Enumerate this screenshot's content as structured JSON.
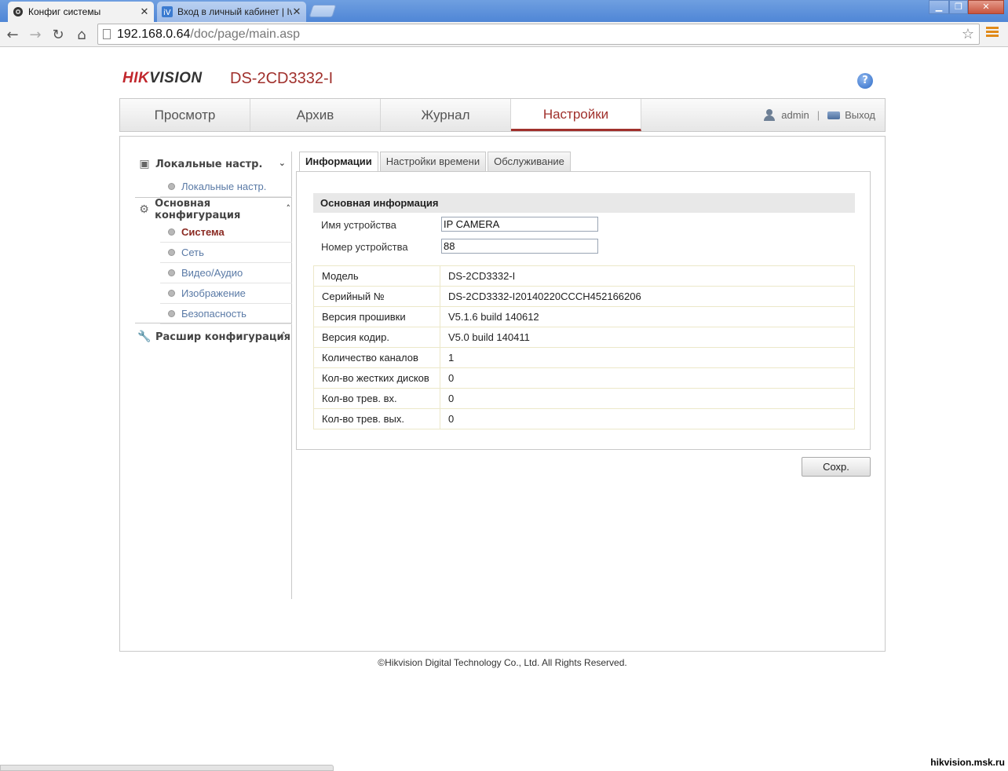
{
  "browser": {
    "tabs": [
      {
        "label": "Конфиг системы",
        "active": true
      },
      {
        "label": "Вход в личный кабинет | Iv",
        "active": false
      }
    ],
    "url_host": "192.168.0.64",
    "url_path": "/doc/page/main.asp"
  },
  "header": {
    "logo_hik": "HIK",
    "logo_vision": "VISION",
    "model": "DS-2CD3332-I",
    "help": "?"
  },
  "nav": {
    "tabs": [
      "Просмотр",
      "Архив",
      "Журнал",
      "Настройки"
    ],
    "active_tab": "Настройки",
    "user": "admin",
    "separator": "|",
    "logout": "Выход"
  },
  "sidebar": {
    "local_title": "Локальные настр.",
    "local_items": [
      "Локальные настр."
    ],
    "basic_title": "Основная конфигурация",
    "basic_items": [
      "Система",
      "Сеть",
      "Видео/Аудио",
      "Изображение",
      "Безопасность"
    ],
    "active_item": "Система",
    "advanced_title": "Расшир конфигурация"
  },
  "subtabs": [
    "Информации",
    "Настройки времени",
    "Обслуживание"
  ],
  "section_title": "Основная информация",
  "form": {
    "device_name_label": "Имя устройства",
    "device_name_value": "IP CAMERA",
    "device_no_label": "Номер устройства",
    "device_no_value": "88"
  },
  "info_rows": [
    {
      "key": "Модель",
      "value": "DS-2CD3332-I"
    },
    {
      "key": "Серийный №",
      "value": "DS-2CD3332-I20140220CCCH452166206"
    },
    {
      "key": "Версия прошивки",
      "value": "V5.1.6 build 140612"
    },
    {
      "key": "Версия кодир.",
      "value": "V5.0 build 140411"
    },
    {
      "key": "Количество каналов",
      "value": "1"
    },
    {
      "key": "Кол-во жестких дисков",
      "value": "0"
    },
    {
      "key": "Кол-во трев. вх.",
      "value": "0"
    },
    {
      "key": "Кол-во трев. вых.",
      "value": "0"
    }
  ],
  "save_label": "Сохр.",
  "footer": "©Hikvision Digital Technology Co., Ltd. All Rights Reserved.",
  "watermark": "hikvision.msk.ru",
  "colors": {
    "brand_red": "#a0302c",
    "link_blue": "#5a7aa6"
  }
}
